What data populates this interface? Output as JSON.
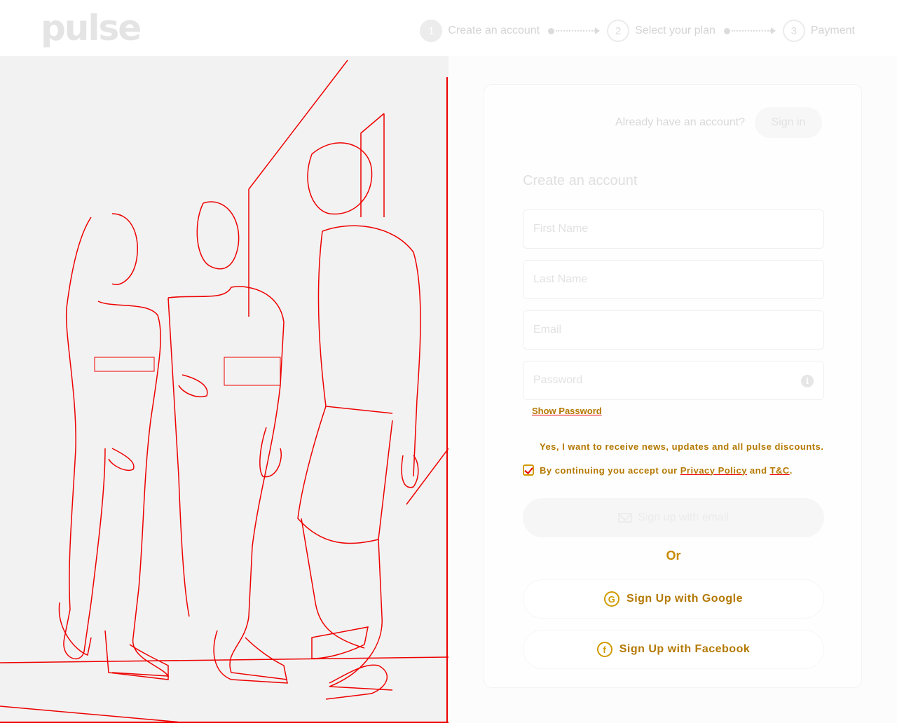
{
  "header": {
    "logo": "pulse",
    "steps": [
      {
        "num": "1",
        "label": "Create an account"
      },
      {
        "num": "2",
        "label": "Select your plan"
      },
      {
        "num": "3",
        "label": "Payment"
      }
    ]
  },
  "signin": {
    "prompt": "Already have an account?",
    "button": "Sign in"
  },
  "form": {
    "title": "Create an account",
    "first_name_placeholder": "First Name",
    "last_name_placeholder": "Last Name",
    "email_placeholder": "Email",
    "password_placeholder": "Password",
    "show_password": "Show Password",
    "newsletter_label": "Yes, I want to receive news, updates and all pulse discounts.",
    "terms_prefix": "By continuing you accept our",
    "privacy_link": "Privacy Policy",
    "terms_and": "and",
    "tc_link": "T&C",
    "terms_suffix": ".",
    "email_signup": "Sign up with email",
    "or": "Or",
    "google_signup": "Sign Up with Google",
    "facebook_signup": "Sign Up with Facebook"
  },
  "icons": {
    "password_info": "info-icon",
    "email_button": "mail-icon",
    "google": "google-icon",
    "facebook": "facebook-icon"
  }
}
